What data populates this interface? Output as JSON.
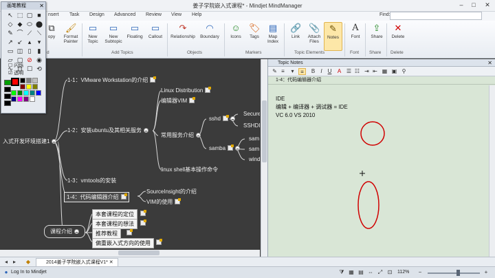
{
  "window": {
    "title": "姜子学院嵌入式课程* - Mindjet MindManager",
    "minimize": "–",
    "maximize": "□",
    "close": "✕"
  },
  "menu": {
    "tabs": [
      "nsert",
      "Task",
      "Design",
      "Advanced",
      "Review",
      "View",
      "Help"
    ],
    "find_label": "Find:"
  },
  "ribbon": {
    "buttons": [
      {
        "label": "opy",
        "icon": "copy-icon",
        "glyph": "⧉"
      },
      {
        "label": "Format\nPainter",
        "icon": "format-painter-icon",
        "glyph": "🖌"
      },
      {
        "label": "New\nTopic",
        "icon": "new-topic-icon",
        "glyph": "▭"
      },
      {
        "label": "New\nSubtopic",
        "icon": "new-subtopic-icon",
        "glyph": "▭"
      },
      {
        "label": "Floating",
        "icon": "floating-topic-icon",
        "glyph": "▭"
      },
      {
        "label": "Callout",
        "icon": "callout-icon",
        "glyph": "▭"
      },
      {
        "label": "Relationship",
        "icon": "relationship-icon",
        "glyph": "↷"
      },
      {
        "label": "Boundary",
        "icon": "boundary-icon",
        "glyph": "◠"
      },
      {
        "label": "Icons",
        "icon": "icons-icon",
        "glyph": "☺"
      },
      {
        "label": "Tags",
        "icon": "tags-icon",
        "glyph": "🏷"
      },
      {
        "label": "Map\nIndex",
        "icon": "map-index-icon",
        "glyph": "▤"
      },
      {
        "label": "Link",
        "icon": "link-icon",
        "glyph": "🔗"
      },
      {
        "label": "Attach\nFiles",
        "icon": "attach-files-icon",
        "glyph": "📎"
      },
      {
        "label": "Notes",
        "icon": "notes-icon",
        "glyph": "✎"
      },
      {
        "label": "Font",
        "icon": "font-icon",
        "glyph": "A"
      },
      {
        "label": "Share",
        "icon": "share-icon",
        "glyph": "⇪"
      },
      {
        "label": "Delete",
        "icon": "delete-icon",
        "glyph": "✕"
      }
    ],
    "groups": [
      "d",
      "Add Topics",
      "Objects",
      "Markers",
      "Topic Elements",
      "Font",
      "Share",
      "Delete"
    ]
  },
  "palette": {
    "title": "画笔教程",
    "close": "✕",
    "tools": [
      "↖",
      "⬚",
      "▢",
      "■",
      "◇",
      "◆",
      "⬭",
      "⬤",
      "✎",
      "⌒",
      "⟋",
      "⟍",
      "↗",
      "↙",
      "▴",
      "▾",
      "▭",
      "◫",
      "▯",
      "▮",
      "▱",
      "▢",
      "⊘",
      "◉",
      "∿",
      "⊡",
      "☐",
      "⟲"
    ],
    "check_flash": "闪烁",
    "check_transparent": "透明",
    "swatch_colors": [
      "#ff0000",
      "#ffffff",
      "#000000",
      "#808080",
      "#c0c0c0",
      "#800000",
      "#ffff00",
      "#808000",
      "#00ff00",
      "#008000",
      "#00ffff",
      "#008080",
      "#0000ff",
      "#000080",
      "#ff00ff",
      "#800080"
    ],
    "main_colors": [
      "#00a000",
      "#ff0000",
      "#000000",
      "#ffffff"
    ]
  },
  "map": {
    "root": "入式开发环境搭建1",
    "t11": "1-1：VMware Workstation的介绍",
    "t12": "1-2：安装ubuntu及其相关服务",
    "t13": "1-3：vmtools的安装",
    "t14": "1-4：代码编辑器介绍",
    "linux_dist": "Linux Distribution",
    "vim": "编辑器VIM",
    "services": "常用服务介绍",
    "sshd": "sshd",
    "samba": "samba",
    "secure": "Secure",
    "sshd2": "SSHDI",
    "sam1": "sam",
    "sam2": "sam",
    "wind": "wind",
    "shell": "linux shell基本操作命令",
    "source_insight": "SourceInsight的介绍",
    "vim_use": "VIM的使用",
    "course": "课程介绍",
    "c1": "本套课程的定位",
    "c2": "本套课程的想法",
    "c3": "推荐教程",
    "c4": "偏重嵌入式方向的使用"
  },
  "notes": {
    "header": "Topic Notes",
    "close": "✕",
    "subtitle": "1-4：代码编辑器介绍",
    "line1": "IDE",
    "line2": "编辑 + 编译器 + 调试器 = IDE",
    "line3": "VC 6.0   VS 2010"
  },
  "tabs": {
    "doc": "2014姜子学院嵌入式课程V1*"
  },
  "status": {
    "login": "Log In to Mindjet",
    "zoom": "112%"
  }
}
